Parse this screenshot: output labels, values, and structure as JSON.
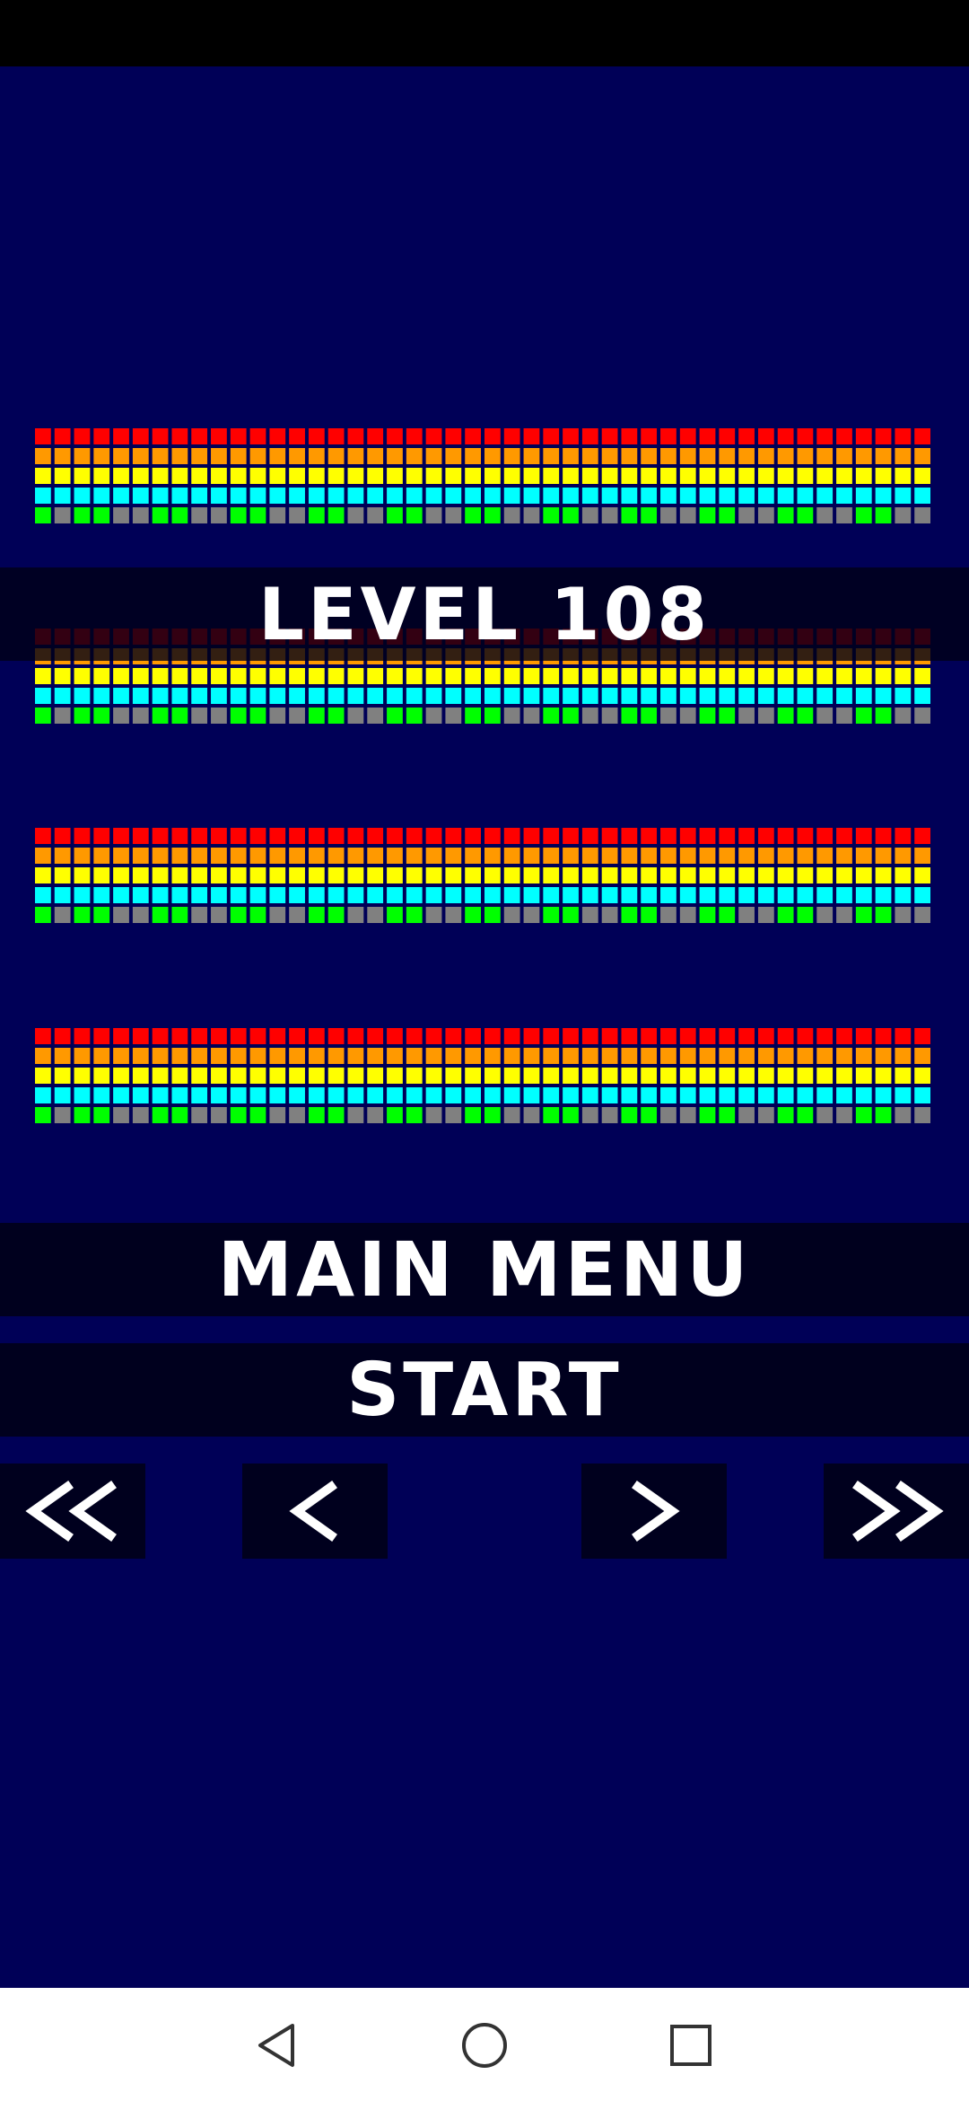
{
  "game": {
    "level_label": "LEVEL 108",
    "main_menu_label": "MAIN MENU",
    "start_label": "START",
    "nav": {
      "first_icon": "double-chevron-left-icon",
      "prev_icon": "chevron-left-icon",
      "next_icon": "chevron-right-icon",
      "last_icon": "double-chevron-right-icon"
    },
    "brick_colors": [
      "#ff0000",
      "#ff9900",
      "#ffff00",
      "#00ffff"
    ],
    "bottom_row_colors": {
      "green": "#00ff00",
      "gray": "#808080"
    },
    "bottom_row_pattern": [
      1,
      0,
      1,
      1,
      0,
      0,
      1,
      1,
      0,
      0,
      1,
      1,
      0,
      0,
      1,
      1,
      0,
      0,
      1,
      1,
      0,
      0,
      1,
      1,
      0,
      0,
      1,
      1,
      0,
      0,
      1,
      1,
      0,
      0,
      1,
      1,
      0,
      0,
      1,
      1,
      0,
      0,
      1,
      1,
      0,
      0
    ]
  },
  "system_nav": {
    "back_icon": "triangle-back-icon",
    "home_icon": "circle-home-icon",
    "recents_icon": "square-recents-icon"
  },
  "colors": {
    "background": "#000057",
    "banner": "#00001e",
    "status_bar": "#000000",
    "nav_bar": "#ffffff"
  }
}
